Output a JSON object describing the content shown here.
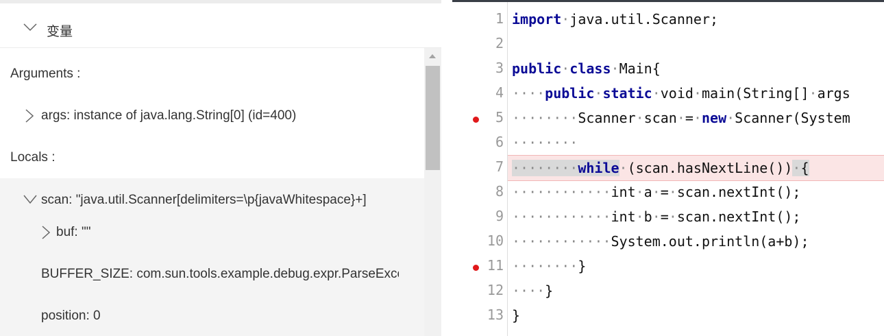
{
  "variables": {
    "title": "变量",
    "arguments_label": "Arguments :",
    "args_item": "args: instance of java.lang.String[0] (id=400)",
    "locals_label": "Locals :",
    "scan_item": "scan: \"java.util.Scanner[delimiters=\\p{javaWhitespace}+]",
    "buf_item": "buf: \"\"",
    "buffer_size_item": "BUFFER_SIZE: com.sun.tools.example.debug.expr.ParseException",
    "position_item": "position: 0"
  },
  "editor": {
    "breakpoint_color": "#e0191b",
    "current_line_highlight": "#fbe5e5",
    "lines": [
      {
        "num": "1",
        "breakpoint": false,
        "tokens": [
          {
            "t": "import",
            "k": "kw"
          },
          {
            "t": "·",
            "k": "ws"
          },
          {
            "t": "java.util.Scanner;",
            "k": ""
          }
        ]
      },
      {
        "num": "2",
        "breakpoint": false,
        "tokens": []
      },
      {
        "num": "3",
        "breakpoint": false,
        "tokens": [
          {
            "t": "public",
            "k": "kw"
          },
          {
            "t": "·",
            "k": "ws"
          },
          {
            "t": "class",
            "k": "kw"
          },
          {
            "t": "·",
            "k": "ws"
          },
          {
            "t": "Main{",
            "k": ""
          }
        ]
      },
      {
        "num": "4",
        "breakpoint": false,
        "tokens": [
          {
            "t": "····",
            "k": "ws"
          },
          {
            "t": "public",
            "k": "kw"
          },
          {
            "t": "·",
            "k": "ws"
          },
          {
            "t": "static",
            "k": "kw"
          },
          {
            "t": "·",
            "k": "ws"
          },
          {
            "t": "void",
            "k": ""
          },
          {
            "t": "·",
            "k": "ws"
          },
          {
            "t": "main(String[]",
            "k": ""
          },
          {
            "t": "·",
            "k": "ws"
          },
          {
            "t": "args",
            "k": ""
          }
        ]
      },
      {
        "num": "5",
        "breakpoint": true,
        "tokens": [
          {
            "t": "········",
            "k": "ws"
          },
          {
            "t": "Scanner",
            "k": ""
          },
          {
            "t": "·",
            "k": "ws"
          },
          {
            "t": "scan",
            "k": ""
          },
          {
            "t": "·",
            "k": "ws"
          },
          {
            "t": "=",
            "k": ""
          },
          {
            "t": "·",
            "k": "ws"
          },
          {
            "t": "new",
            "k": "kw"
          },
          {
            "t": "·",
            "k": "ws"
          },
          {
            "t": "Scanner(System",
            "k": ""
          }
        ]
      },
      {
        "num": "6",
        "breakpoint": false,
        "tokens": [
          {
            "t": "········",
            "k": "ws"
          }
        ]
      },
      {
        "num": "7",
        "breakpoint": false,
        "current": true,
        "tokens": [
          {
            "t": "········",
            "k": "ws hl"
          },
          {
            "t": "while",
            "k": "kw hl"
          },
          {
            "t": "·",
            "k": "ws"
          },
          {
            "t": "(scan.hasNextLine())",
            "k": ""
          },
          {
            "t": "·",
            "k": "ws hl"
          },
          {
            "t": "{",
            "k": "hl"
          }
        ]
      },
      {
        "num": "8",
        "breakpoint": false,
        "tokens": [
          {
            "t": "············",
            "k": "ws"
          },
          {
            "t": "int",
            "k": ""
          },
          {
            "t": "·",
            "k": "ws"
          },
          {
            "t": "a",
            "k": ""
          },
          {
            "t": "·",
            "k": "ws"
          },
          {
            "t": "=",
            "k": ""
          },
          {
            "t": "·",
            "k": "ws"
          },
          {
            "t": "scan.nextInt();",
            "k": ""
          }
        ]
      },
      {
        "num": "9",
        "breakpoint": false,
        "tokens": [
          {
            "t": "············",
            "k": "ws"
          },
          {
            "t": "int",
            "k": ""
          },
          {
            "t": "·",
            "k": "ws"
          },
          {
            "t": "b",
            "k": ""
          },
          {
            "t": "·",
            "k": "ws"
          },
          {
            "t": "=",
            "k": ""
          },
          {
            "t": "·",
            "k": "ws"
          },
          {
            "t": "scan.nextInt();",
            "k": ""
          }
        ]
      },
      {
        "num": "10",
        "breakpoint": false,
        "tokens": [
          {
            "t": "············",
            "k": "ws"
          },
          {
            "t": "System.out.println(a+b);",
            "k": ""
          }
        ]
      },
      {
        "num": "11",
        "breakpoint": true,
        "tokens": [
          {
            "t": "········",
            "k": "ws"
          },
          {
            "t": "}",
            "k": ""
          }
        ]
      },
      {
        "num": "12",
        "breakpoint": false,
        "tokens": [
          {
            "t": "····",
            "k": "ws"
          },
          {
            "t": "}",
            "k": ""
          }
        ]
      },
      {
        "num": "13",
        "breakpoint": false,
        "tokens": [
          {
            "t": "}",
            "k": ""
          }
        ]
      }
    ]
  }
}
